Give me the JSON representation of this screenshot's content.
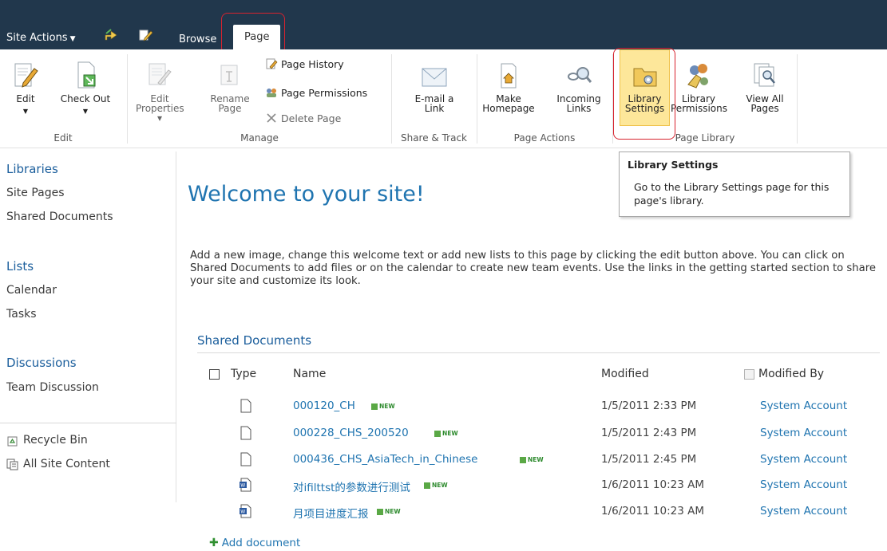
{
  "topbar": {
    "site_actions": "Site Actions",
    "tabs": {
      "browse": "Browse",
      "page": "Page"
    }
  },
  "ribbon": {
    "edit_group": {
      "edit": "Edit",
      "check_out": "Check Out",
      "label": "Edit"
    },
    "manage_group": {
      "edit_properties_1": "Edit",
      "edit_properties_2": "Properties",
      "rename_1": "Rename",
      "rename_2": "Page",
      "page_history": "Page History",
      "page_permissions": "Page Permissions",
      "delete_page": "Delete Page",
      "label": "Manage"
    },
    "share_group": {
      "email_1": "E-mail a",
      "email_2": "Link",
      "label": "Share & Track"
    },
    "actions_group": {
      "make_home_1": "Make",
      "make_home_2": "Homepage",
      "incoming_1": "Incoming",
      "incoming_2": "Links",
      "label": "Page Actions"
    },
    "library_group": {
      "settings_1": "Library",
      "settings_2": "Settings",
      "permissions_1": "Library",
      "permissions_2": "Permissions",
      "view_all_1": "View All",
      "view_all_2": "Pages",
      "label": "Page Library"
    }
  },
  "tooltip": {
    "title": "Library Settings",
    "body": "Go to the Library Settings page for this page's library."
  },
  "leftnav": {
    "libraries": "Libraries",
    "site_pages": "Site Pages",
    "shared_documents": "Shared Documents",
    "lists": "Lists",
    "calendar": "Calendar",
    "tasks": "Tasks",
    "discussions": "Discussions",
    "team_discussion": "Team Discussion",
    "recycle_bin": "Recycle Bin",
    "all_site_content": "All Site Content"
  },
  "main": {
    "welcome": "Welcome to your site!",
    "intro": "Add a new image, change this welcome text or add new lists to this page by clicking the edit button above. You can click on Shared Documents to add files or on the calendar to create new team events. Use the links in the getting started section to share your site and customize its look.",
    "shared_documents_title": "Shared Documents",
    "columns": {
      "type": "Type",
      "name": "Name",
      "modified": "Modified",
      "modified_by": "Modified By"
    },
    "new_label": "NEW",
    "rows": [
      {
        "name": "000120_CH",
        "modified": "1/5/2011 2:33 PM",
        "modified_by": "System Account",
        "type": "generic"
      },
      {
        "name": "000228_CHS_200520",
        "modified": "1/5/2011 2:43 PM",
        "modified_by": "System Account",
        "type": "generic"
      },
      {
        "name": "000436_CHS_AsiaTech_in_Chinese",
        "modified": "1/5/2011 2:45 PM",
        "modified_by": "System Account",
        "type": "generic"
      },
      {
        "name": "对ifilttst的参数进行测试",
        "modified": "1/6/2011 10:23 AM",
        "modified_by": "System Account",
        "type": "word"
      },
      {
        "name": "月项目进度汇报",
        "modified": "1/6/2011 10:23 AM",
        "modified_by": "System Account",
        "type": "word"
      }
    ],
    "add_document": "Add document"
  },
  "colors": {
    "topbar": "#21374c",
    "link": "#1f74b0",
    "highlight": "#d7232f",
    "active_button": "#fde79a"
  }
}
